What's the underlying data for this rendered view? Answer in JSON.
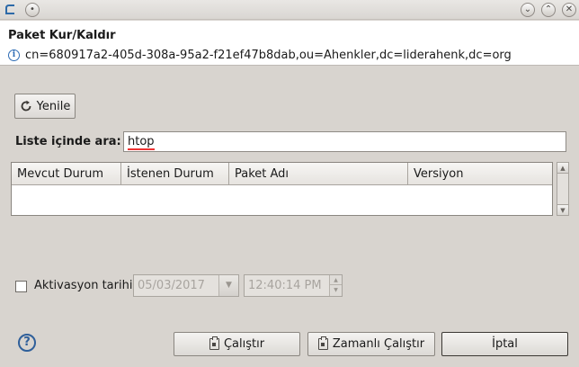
{
  "window": {
    "close_glyph": "✕",
    "minimize_glyph": "⌄",
    "maximize_glyph": "⌃"
  },
  "header": {
    "title": "Paket Kur/Kaldır",
    "info": "cn=680917a2-405d-308a-95a2-f21ef47b8dab,ou=Ahenkler,dc=liderahenk,dc=org"
  },
  "toolbar": {
    "refresh_label": "Yenile"
  },
  "search": {
    "label": "Liste içinde ara:",
    "value": "htop"
  },
  "table": {
    "columns": [
      "Mevcut Durum",
      "İstenen Durum",
      "Paket Adı",
      "Versiyon"
    ],
    "rows": []
  },
  "activation": {
    "checkbox_label": "Aktivasyon tarihi",
    "checked": false,
    "date": "05/03/2017",
    "time": "12:40:14 PM"
  },
  "footer": {
    "help_glyph": "?",
    "run_label": "Çalıştır",
    "scheduled_run_label": "Zamanlı Çalıştır",
    "cancel_label": "İptal"
  },
  "colors": {
    "background": "#d8d4cf",
    "header_bg": "#ffffff",
    "info_icon": "#2f6db5",
    "spellcheck_underline": "#e33333"
  }
}
